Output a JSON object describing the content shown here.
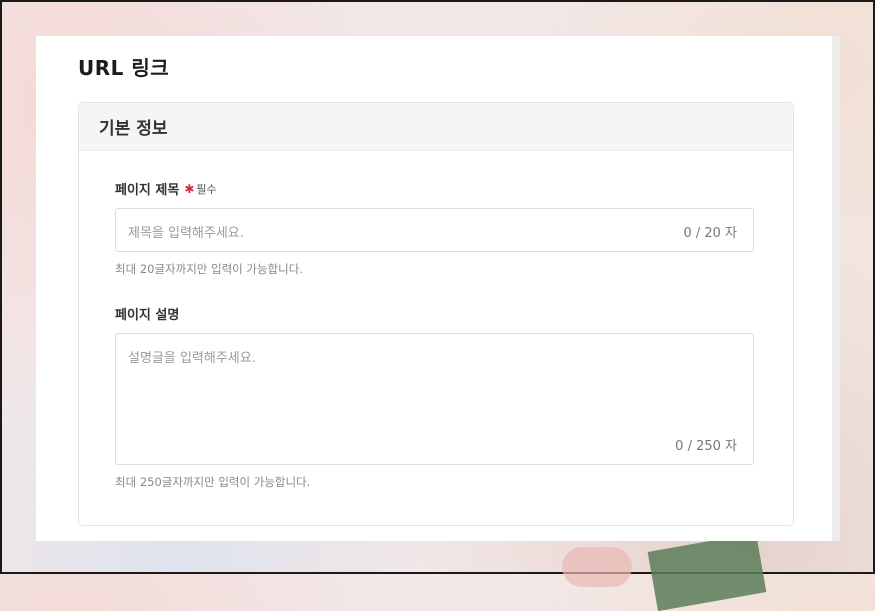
{
  "page": {
    "title": "URL 링크"
  },
  "section": {
    "header": "기본 정보"
  },
  "fields": {
    "page_title": {
      "label": "페이지 제목",
      "required_mark": "✱",
      "required_text": "필수",
      "placeholder": "제목을 입력해주세요.",
      "counter": "0 / 20 자",
      "help": "최대 20글자까지만 입력이 가능합니다."
    },
    "page_description": {
      "label": "페이지 설명",
      "placeholder": "설명글을 입력해주세요.",
      "counter": "0 / 250 자",
      "help": "최대 250글자까지만 입력이 가능합니다."
    }
  },
  "colors": {
    "required": "#e0293a",
    "header_bg": "#f5f5f7",
    "border": "#dcdcdf"
  }
}
